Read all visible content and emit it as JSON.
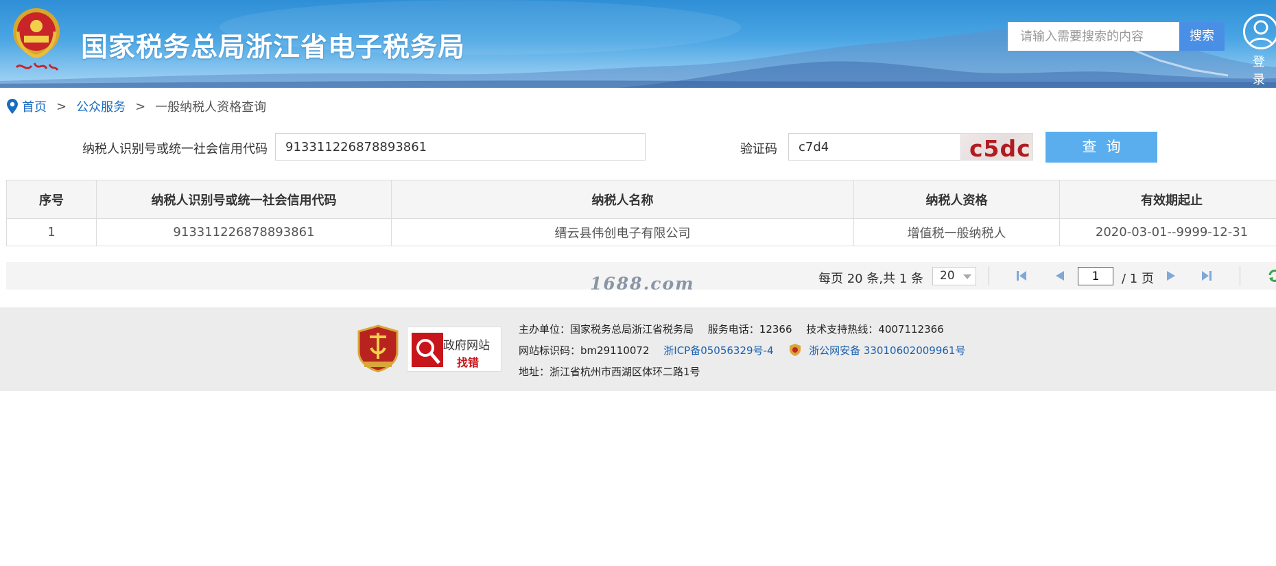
{
  "header": {
    "site_title": "国家税务总局浙江省电子税务局",
    "search_placeholder": "请输入需要搜索的内容",
    "search_button": "搜索",
    "login_label": "登录"
  },
  "breadcrumb": {
    "home": "首页",
    "separator": ">",
    "section": "公众服务",
    "current": "一般纳税人资格查询"
  },
  "form": {
    "taxpayer_id_label": "纳税人识别号或统一社会信用代码",
    "taxpayer_id_value": "913311226878893861",
    "captcha_label": "验证码",
    "captcha_value": "c7d4",
    "captcha_image_text": "c5dc",
    "query_button": "查询"
  },
  "table": {
    "headers": [
      "序号",
      "纳税人识别号或统一社会信用代码",
      "纳税人名称",
      "纳税人资格",
      "有效期起止"
    ],
    "rows": [
      [
        "1",
        "913311226878893861",
        "缙云县伟创电子有限公司",
        "增值税一般纳税人",
        "2020-03-01--9999-12-31"
      ]
    ]
  },
  "pager": {
    "info": "每页 20 条,共 1 条",
    "page_size": "20",
    "current_page": "1",
    "total_pages": "/ 1 页"
  },
  "watermark": "1688.com",
  "footer": {
    "gov_badge_line1": "政府网站",
    "gov_badge_line2": "找错",
    "line1_host": "主办单位：国家税务总局浙江省税务局",
    "line1_phone": "服务电话：12366",
    "line1_support": "技术支持热线：4007112366",
    "line2_site_code": "网站标识码：bm29110072",
    "line2_icp": "浙ICP备05056329号-4",
    "line2_police": "浙公网安备 33010602009961号",
    "line3_address": "地址：浙江省杭州市西湖区体环二路1号"
  },
  "colors": {
    "accent_blue": "#4a8fe6",
    "query_button": "#5aaeee",
    "link_blue": "#1a6bc2",
    "captcha_red": "#b01c22"
  }
}
